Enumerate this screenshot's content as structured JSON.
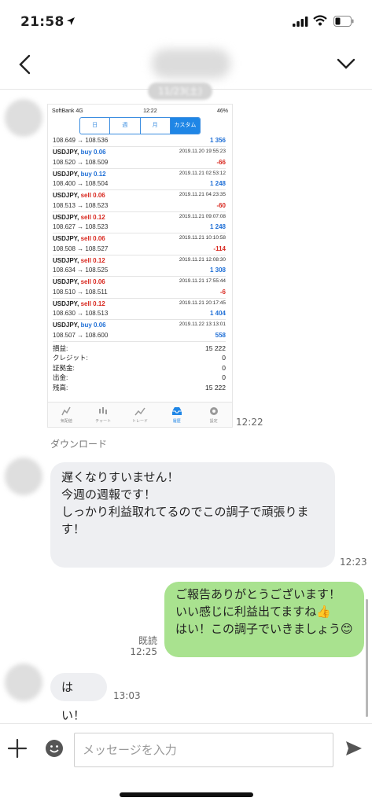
{
  "status_bar": {
    "time": "21:58"
  },
  "header": {
    "date_label": "11/23(土)"
  },
  "shot": {
    "carrier": "SoftBank  4G",
    "time": "12:22",
    "battery": "46%",
    "tabs": [
      "日",
      "週",
      "月",
      "カスタム"
    ],
    "first_row": {
      "prices": "108.649 → 108.536",
      "pl": "1 356"
    },
    "rows": [
      {
        "symbol": "USDJPY,",
        "dir": "buy 0.06",
        "side": "buy",
        "prices": "108.520 → 108.509",
        "dt": "2019.11.20 19:55:23",
        "pl": "-66",
        "sign": "neg"
      },
      {
        "symbol": "USDJPY,",
        "dir": "buy 0.12",
        "side": "buy",
        "prices": "108.400 → 108.504",
        "dt": "2019.11.21 02:53:12",
        "pl": "1 248",
        "sign": "pos"
      },
      {
        "symbol": "USDJPY,",
        "dir": "sell 0.06",
        "side": "sell",
        "prices": "108.513 → 108.523",
        "dt": "2019.11.21 04:23:35",
        "pl": "-60",
        "sign": "neg"
      },
      {
        "symbol": "USDJPY,",
        "dir": "sell 0.12",
        "side": "sell",
        "prices": "108.627 → 108.523",
        "dt": "2019.11.21 09:07:08",
        "pl": "1 248",
        "sign": "pos"
      },
      {
        "symbol": "USDJPY,",
        "dir": "sell 0.06",
        "side": "sell",
        "prices": "108.508 → 108.527",
        "dt": "2019.11.21 10:10:58",
        "pl": "-114",
        "sign": "neg"
      },
      {
        "symbol": "USDJPY,",
        "dir": "sell 0.12",
        "side": "sell",
        "prices": "108.634 → 108.525",
        "dt": "2019.11.21 12:08:30",
        "pl": "1 308",
        "sign": "pos"
      },
      {
        "symbol": "USDJPY,",
        "dir": "sell 0.06",
        "side": "sell",
        "prices": "108.510 → 108.511",
        "dt": "2019.11.21 17:55:44",
        "pl": "-6",
        "sign": "neg"
      },
      {
        "symbol": "USDJPY,",
        "dir": "sell 0.12",
        "side": "sell",
        "prices": "108.630 → 108.513",
        "dt": "2019.11.21 20:17:45",
        "pl": "1 404",
        "sign": "pos"
      },
      {
        "symbol": "USDJPY,",
        "dir": "buy 0.06",
        "side": "buy",
        "prices": "108.507 → 108.600",
        "dt": "2019.11.22 13:13:01",
        "pl": "558",
        "sign": "pos"
      }
    ],
    "summary": [
      {
        "label": "損益:",
        "value": "15 222"
      },
      {
        "label": "クレジット:",
        "value": "0"
      },
      {
        "label": "証拠金:",
        "value": "0"
      },
      {
        "label": "出金:",
        "value": "0"
      },
      {
        "label": "残高:",
        "value": "15 222"
      }
    ],
    "bottom_tabs": [
      "気配値",
      "チャート",
      "トレード",
      "履歴",
      "設定"
    ]
  },
  "messages": {
    "image_time": "12:22",
    "download_label": "ダウンロード",
    "msg1": {
      "lines": [
        "遅くなりすいません！",
        "",
        "今週の週報です！",
        "",
        "しっかり利益取れてるのでこの調子で頑張りま",
        "す！"
      ],
      "time": "12:23"
    },
    "msg2": {
      "lines": [
        "ご報告ありがとうございます！",
        "いい感じに利益出てますね👍",
        "",
        "はい！この調子でいきましょう😊"
      ],
      "read": "既読",
      "time": "12:25"
    },
    "msg3": {
      "text": "はい！",
      "time": "13:03"
    }
  },
  "input": {
    "placeholder": "メッセージを入力"
  },
  "colors": {
    "sent_bubble": "#a9e28f",
    "received_bubble": "#eeeff2",
    "buy": "#1f6fd6",
    "sell": "#d8281f"
  }
}
